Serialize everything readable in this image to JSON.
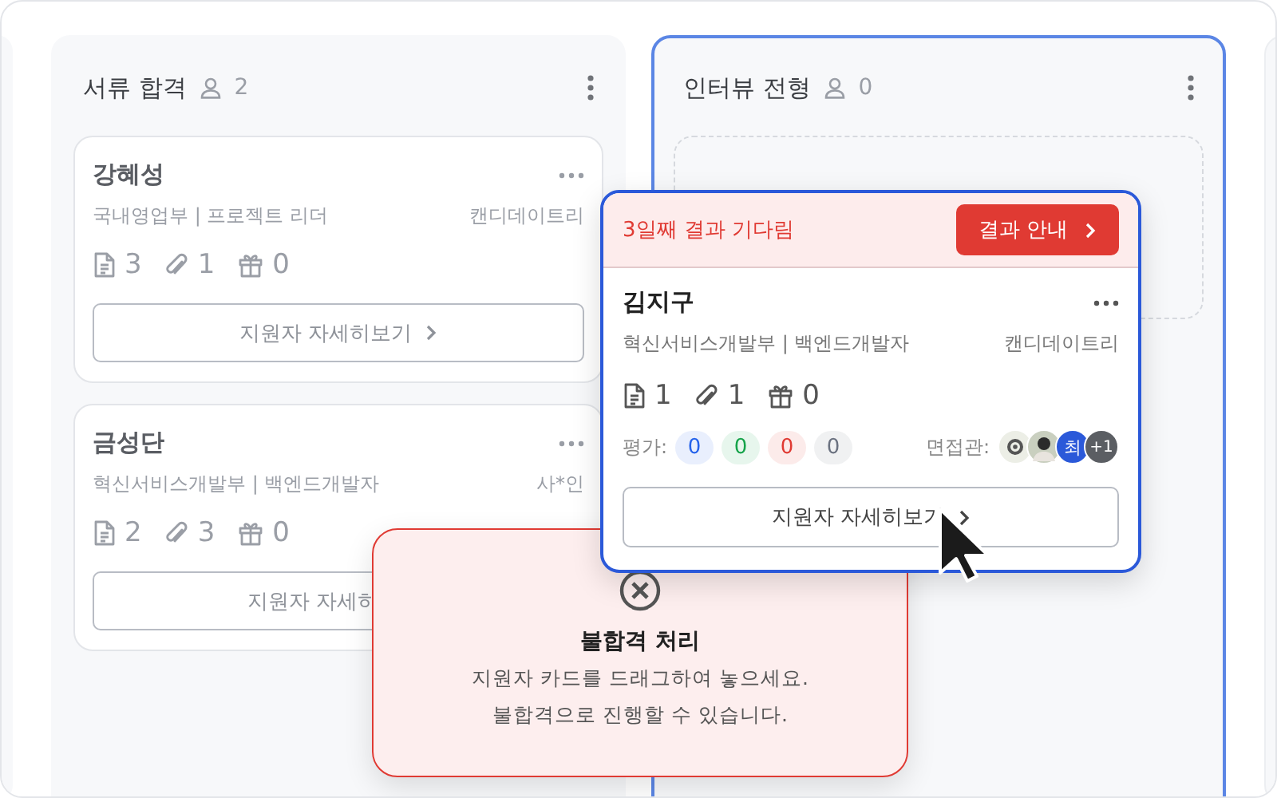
{
  "columns": [
    {
      "title": "서류 합격",
      "count": "2",
      "highlighted": false,
      "cards": [
        {
          "name": "강혜성",
          "department": "국내영업부 | 프로젝트 리더",
          "source": "캔디데이트리",
          "documents": "3",
          "attachments": "1",
          "gifts": "0",
          "button": "지원자 자세히보기",
          "button_chevron": true
        },
        {
          "name": "금성단",
          "department": "혁신서비스개발부 | 백엔드개발자",
          "source": "사*인",
          "documents": "2",
          "attachments": "3",
          "gifts": "0",
          "button": "지원자 자세히",
          "button_chevron": false
        }
      ]
    },
    {
      "title": "인터뷰 전형",
      "count": "0",
      "highlighted": true
    }
  ],
  "dragged_card": {
    "status": "3일째 결과 기다림",
    "action": "결과 안내",
    "name": "김지구",
    "department": "혁신서비스개발부 | 백엔드개발자",
    "source": "캔디데이트리",
    "documents": "1",
    "attachments": "1",
    "gifts": "0",
    "evaluation_label": "평가:",
    "scores": [
      {
        "value": "0",
        "color": "#2563eb"
      },
      {
        "value": "0",
        "color": "#16a34a"
      },
      {
        "value": "0",
        "color": "#e03a33"
      },
      {
        "value": "0",
        "color": "#6b7280"
      }
    ],
    "interviewer_label": "면접관:",
    "interviewers": [
      {
        "kind": "logo"
      },
      {
        "kind": "photo"
      },
      {
        "kind": "initial",
        "text": "최"
      },
      {
        "kind": "more",
        "text": "+1"
      }
    ],
    "button": "지원자 자세히보기"
  },
  "drop_zone": {
    "title": "불합격 처리",
    "lines": [
      "지원자 카드를 드래그하여 놓으세요.",
      "불합격으로 진행할 수 있습니다."
    ]
  }
}
